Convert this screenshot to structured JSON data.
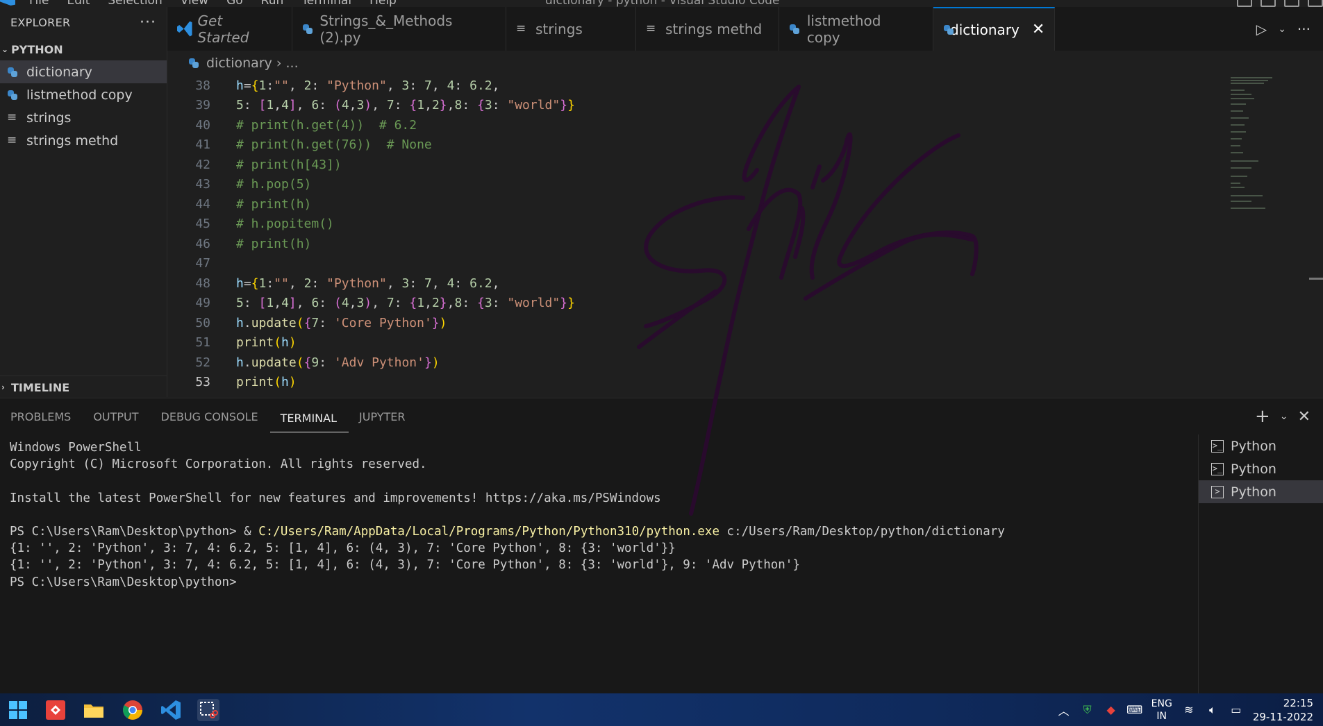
{
  "titlebar": {
    "menu": [
      "File",
      "Edit",
      "Selection",
      "View",
      "Go",
      "Run",
      "Terminal",
      "Help"
    ],
    "window_title": "dictionary - python - Visual Studio Code"
  },
  "sidebar": {
    "header": "EXPLORER",
    "more": "···",
    "folder": "PYTHON",
    "items": [
      {
        "label": "dictionary",
        "icon": "python-file-icon",
        "active": true
      },
      {
        "label": "listmethod copy",
        "icon": "python-file-icon"
      },
      {
        "label": "strings",
        "icon": "text-file-icon"
      },
      {
        "label": "strings methd",
        "icon": "text-file-icon"
      }
    ],
    "timeline": "TIMELINE"
  },
  "tabs": [
    {
      "label": "Get Started",
      "icon": "vscode-icon"
    },
    {
      "label": "Strings_&_Methods (2).py",
      "icon": "python-file-icon"
    },
    {
      "label": "strings",
      "icon": "text-file-icon"
    },
    {
      "label": "strings methd",
      "icon": "text-file-icon"
    },
    {
      "label": "listmethod copy",
      "icon": "python-file-icon"
    },
    {
      "label": "dictionary",
      "icon": "python-file-icon",
      "active": true
    }
  ],
  "breadcrumb": {
    "file": "dictionary",
    "rest": "..."
  },
  "editor": {
    "line_numbers": [
      "38",
      "39",
      "40",
      "41",
      "42",
      "43",
      "44",
      "45",
      "46",
      "47",
      "48",
      "49",
      "50",
      "51",
      "52",
      "53"
    ],
    "current_line": "53"
  },
  "panel": {
    "tabs": [
      "PROBLEMS",
      "OUTPUT",
      "DEBUG CONSOLE",
      "TERMINAL",
      "JUPYTER"
    ],
    "active_tab": "TERMINAL",
    "terminal": {
      "l1": "Windows PowerShell",
      "l2": "Copyright (C) Microsoft Corporation. All rights reserved.",
      "l3": "Install the latest PowerShell for new features and improvements! https://aka.ms/PSWindows",
      "prompt": "PS C:\\Users\\Ram\\Desktop\\python> & ",
      "exe": "C:/Users/Ram/AppData/Local/Programs/Python/Python310/python.exe",
      "script": " c:/Users/Ram/Desktop/python/dictionary",
      "out1": "{1: '', 2: 'Python', 3: 7, 4: 6.2, 5: [1, 4], 6: (4, 3), 7: 'Core Python', 8: {3: 'world'}}",
      "out2": "{1: '', 2: 'Python', 3: 7, 4: 6.2, 5: [1, 4], 6: (4, 3), 7: 'Core Python', 8: {3: 'world'}, 9: 'Adv Python'}",
      "final_prompt": "PS C:\\Users\\Ram\\Desktop\\python>"
    },
    "terminals": [
      "Python",
      "Python",
      "Python"
    ]
  },
  "taskbar": {
    "lang_top": "ENG",
    "lang_bottom": "IN",
    "time": "22:15",
    "date": "29-11-2022"
  },
  "colors": {
    "accent": "#0078d4",
    "signature": "#2a0a2e"
  }
}
